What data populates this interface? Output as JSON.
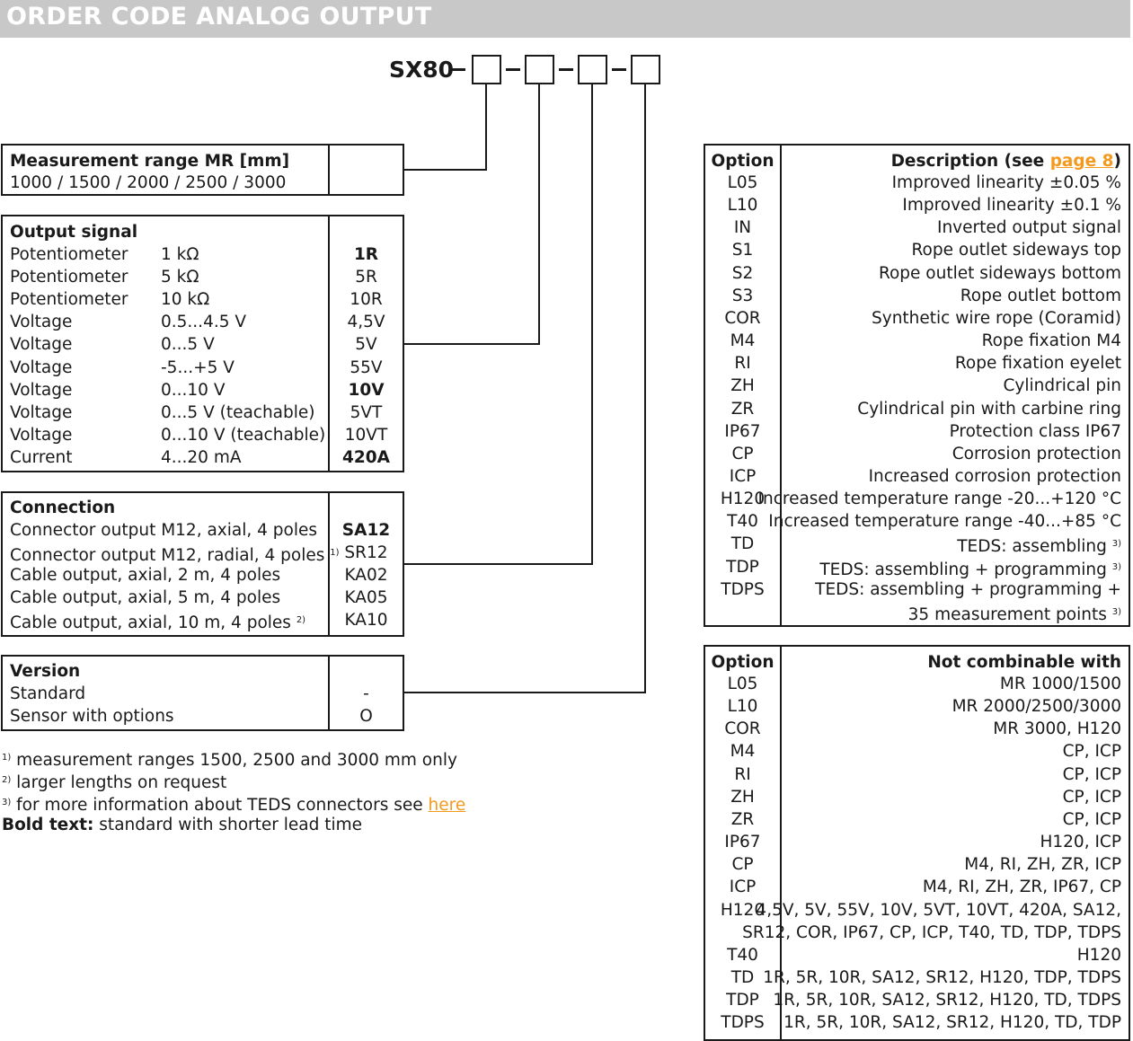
{
  "header": {
    "title": "ORDER CODE ANALOG OUTPUT"
  },
  "order_code": {
    "prefix": "SX80",
    "separator": "–"
  },
  "measurement_range": {
    "title": "Measurement range MR [mm]",
    "values": "1000 / 1500 / 2000 / 2500 / 3000"
  },
  "output_signal": {
    "title": "Output signal",
    "rows": [
      {
        "type": "Potentiometer",
        "spec": "1 kΩ",
        "code": "1R",
        "bold": true
      },
      {
        "type": "Potentiometer",
        "spec": "5 kΩ",
        "code": "5R",
        "bold": false
      },
      {
        "type": "Potentiometer",
        "spec": "10 kΩ",
        "code": "10R",
        "bold": false
      },
      {
        "type": "Voltage",
        "spec": "0.5...4.5 V",
        "code": "4,5V",
        "bold": false
      },
      {
        "type": "Voltage",
        "spec": "0...5 V",
        "code": "5V",
        "bold": false
      },
      {
        "type": "Voltage",
        "spec": "-5...+5 V",
        "code": "55V",
        "bold": false
      },
      {
        "type": "Voltage",
        "spec": "0...10 V",
        "code": "10V",
        "bold": true
      },
      {
        "type": "Voltage",
        "spec": "0...5 V (teachable)",
        "code": "5VT",
        "bold": false
      },
      {
        "type": "Voltage",
        "spec": "0...10 V (teachable)",
        "code": "10VT",
        "bold": false
      },
      {
        "type": "Current",
        "spec": "4...20 mA",
        "code": "420A",
        "bold": true
      }
    ]
  },
  "connection": {
    "title": "Connection",
    "rows": [
      {
        "label": "Connector output M12, axial, 4 poles",
        "note": "",
        "code": "SA12",
        "bold": true
      },
      {
        "label": "Connector output M12, radial, 4 poles",
        "note": "1)",
        "code": "SR12",
        "bold": false
      },
      {
        "label": "Cable output, axial, 2 m, 4 poles",
        "note": "",
        "code": "KA02",
        "bold": false
      },
      {
        "label": "Cable output, axial, 5 m, 4 poles",
        "note": "",
        "code": "KA05",
        "bold": false
      },
      {
        "label": "Cable output, axial, 10 m, 4 poles",
        "note": "2)",
        "code": "KA10",
        "bold": false
      }
    ]
  },
  "version": {
    "title": "Version",
    "rows": [
      {
        "label": "Standard",
        "code": "-"
      },
      {
        "label": "Sensor with options",
        "code": "O"
      }
    ]
  },
  "footnotes": [
    {
      "mark": "1)",
      "text": "measurement ranges 1500, 2500 and 3000 mm only",
      "link": ""
    },
    {
      "mark": "2)",
      "text": "larger lengths on request",
      "link": ""
    },
    {
      "mark": "3)",
      "text": "for more information about TEDS connectors see ",
      "link": "here"
    }
  ],
  "bold_note": {
    "label": "Bold text:",
    "text": "standard with shorter lead time"
  },
  "options_table": {
    "col1": "Option",
    "col2_prefix": "Description (see ",
    "col2_link": "page 8",
    "col2_suffix": ")",
    "rows": [
      {
        "option": "L05",
        "desc": "Improved linearity ±0.05 %",
        "note": ""
      },
      {
        "option": "L10",
        "desc": "Improved linearity ±0.1 %",
        "note": ""
      },
      {
        "option": "IN",
        "desc": "Inverted output signal",
        "note": ""
      },
      {
        "option": "S1",
        "desc": "Rope outlet sideways top",
        "note": ""
      },
      {
        "option": "S2",
        "desc": "Rope outlet sideways bottom",
        "note": ""
      },
      {
        "option": "S3",
        "desc": "Rope outlet bottom",
        "note": ""
      },
      {
        "option": "COR",
        "desc": "Synthetic wire rope (Coramid)",
        "note": ""
      },
      {
        "option": "M4",
        "desc": "Rope fixation M4",
        "note": ""
      },
      {
        "option": "RI",
        "desc": "Rope fixation eyelet",
        "note": ""
      },
      {
        "option": "ZH",
        "desc": "Cylindrical pin",
        "note": ""
      },
      {
        "option": "ZR",
        "desc": "Cylindrical pin with carbine ring",
        "note": ""
      },
      {
        "option": "IP67",
        "desc": "Protection class IP67",
        "note": ""
      },
      {
        "option": "CP",
        "desc": "Corrosion protection",
        "note": ""
      },
      {
        "option": "ICP",
        "desc": "Increased corrosion protection",
        "note": ""
      },
      {
        "option": "H120",
        "desc": "Increased temperature range -20...+120 °C",
        "note": ""
      },
      {
        "option": "T40",
        "desc": "Increased temperature range -40...+85 °C",
        "note": ""
      },
      {
        "option": "TD",
        "desc": "TEDS: assembling",
        "note": "3)"
      },
      {
        "option": "TDP",
        "desc": "TEDS: assembling + programming",
        "note": "3)"
      },
      {
        "option": "TDPS",
        "desc": "TEDS: assembling + programming +",
        "note": ""
      },
      {
        "option": "",
        "desc": "35 measurement points",
        "note": "3)"
      }
    ]
  },
  "combo_table": {
    "col1": "Option",
    "col2": "Not combinable with",
    "rows": [
      {
        "option": "L05",
        "desc": "MR 1000/1500"
      },
      {
        "option": "L10",
        "desc": "MR 2000/2500/3000"
      },
      {
        "option": "COR",
        "desc": "MR 3000, H120"
      },
      {
        "option": "M4",
        "desc": "CP, ICP"
      },
      {
        "option": "RI",
        "desc": "CP, ICP"
      },
      {
        "option": "ZH",
        "desc": "CP, ICP"
      },
      {
        "option": "ZR",
        "desc": "CP, ICP"
      },
      {
        "option": "IP67",
        "desc": "H120, ICP"
      },
      {
        "option": "CP",
        "desc": "M4, RI, ZH, ZR, ICP"
      },
      {
        "option": "ICP",
        "desc": "M4, RI, ZH, ZR, IP67, CP"
      },
      {
        "option": "H120",
        "desc": "4,5V, 5V, 55V, 10V, 5VT, 10VT, 420A, SA12,"
      },
      {
        "option": "",
        "desc": "SR12, COR, IP67, CP, ICP, T40, TD, TDP, TDPS"
      },
      {
        "option": "T40",
        "desc": "H120"
      },
      {
        "option": "TD",
        "desc": "1R, 5R, 10R, SA12, SR12, H120, TDP, TDPS"
      },
      {
        "option": "TDP",
        "desc": "1R, 5R, 10R, SA12, SR12, H120, TD, TDPS"
      },
      {
        "option": "TDPS",
        "desc": "1R, 5R, 10R, SA12, SR12, H120, TD, TDP"
      }
    ]
  }
}
